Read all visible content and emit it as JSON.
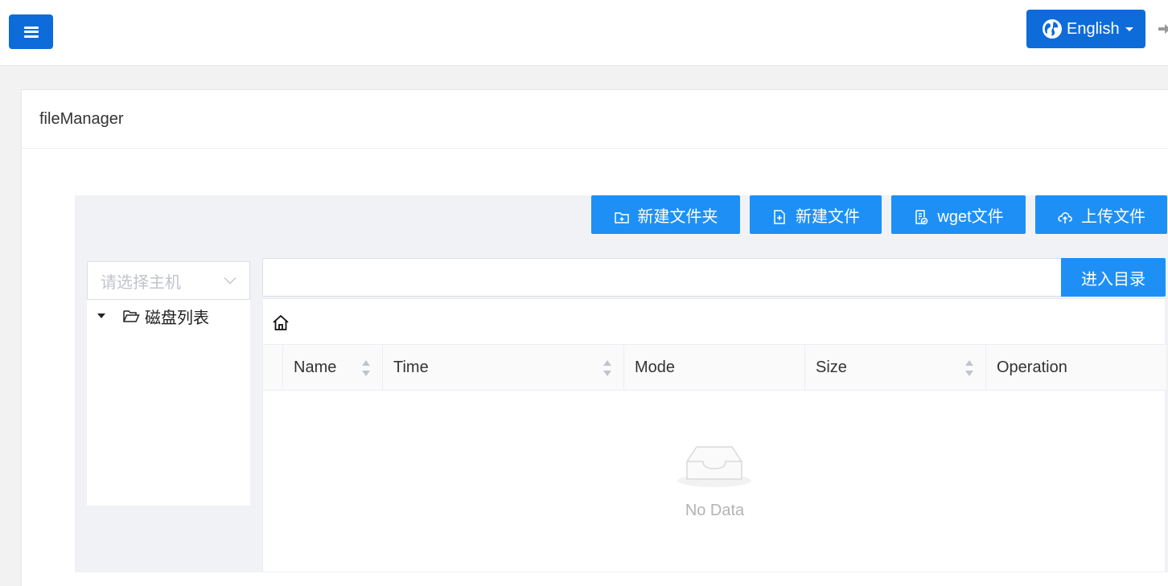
{
  "topbar": {
    "language": "English"
  },
  "card": {
    "title": "fileManager"
  },
  "toolbar": {
    "new_folder": "新建文件夹",
    "new_file": "新建文件",
    "wget_file": "wget文件",
    "upload_file": "上传文件"
  },
  "host_select": {
    "placeholder": "请选择主机"
  },
  "tree": {
    "root_label": "磁盘列表"
  },
  "path": {
    "value": "",
    "enter_label": "进入目录"
  },
  "table": {
    "columns": [
      "Name",
      "Time",
      "Mode",
      "Size",
      "Operation"
    ],
    "empty_text": "No Data"
  },
  "colors": {
    "primary": "#1e90f5",
    "header_blue": "#0d6cd9"
  }
}
